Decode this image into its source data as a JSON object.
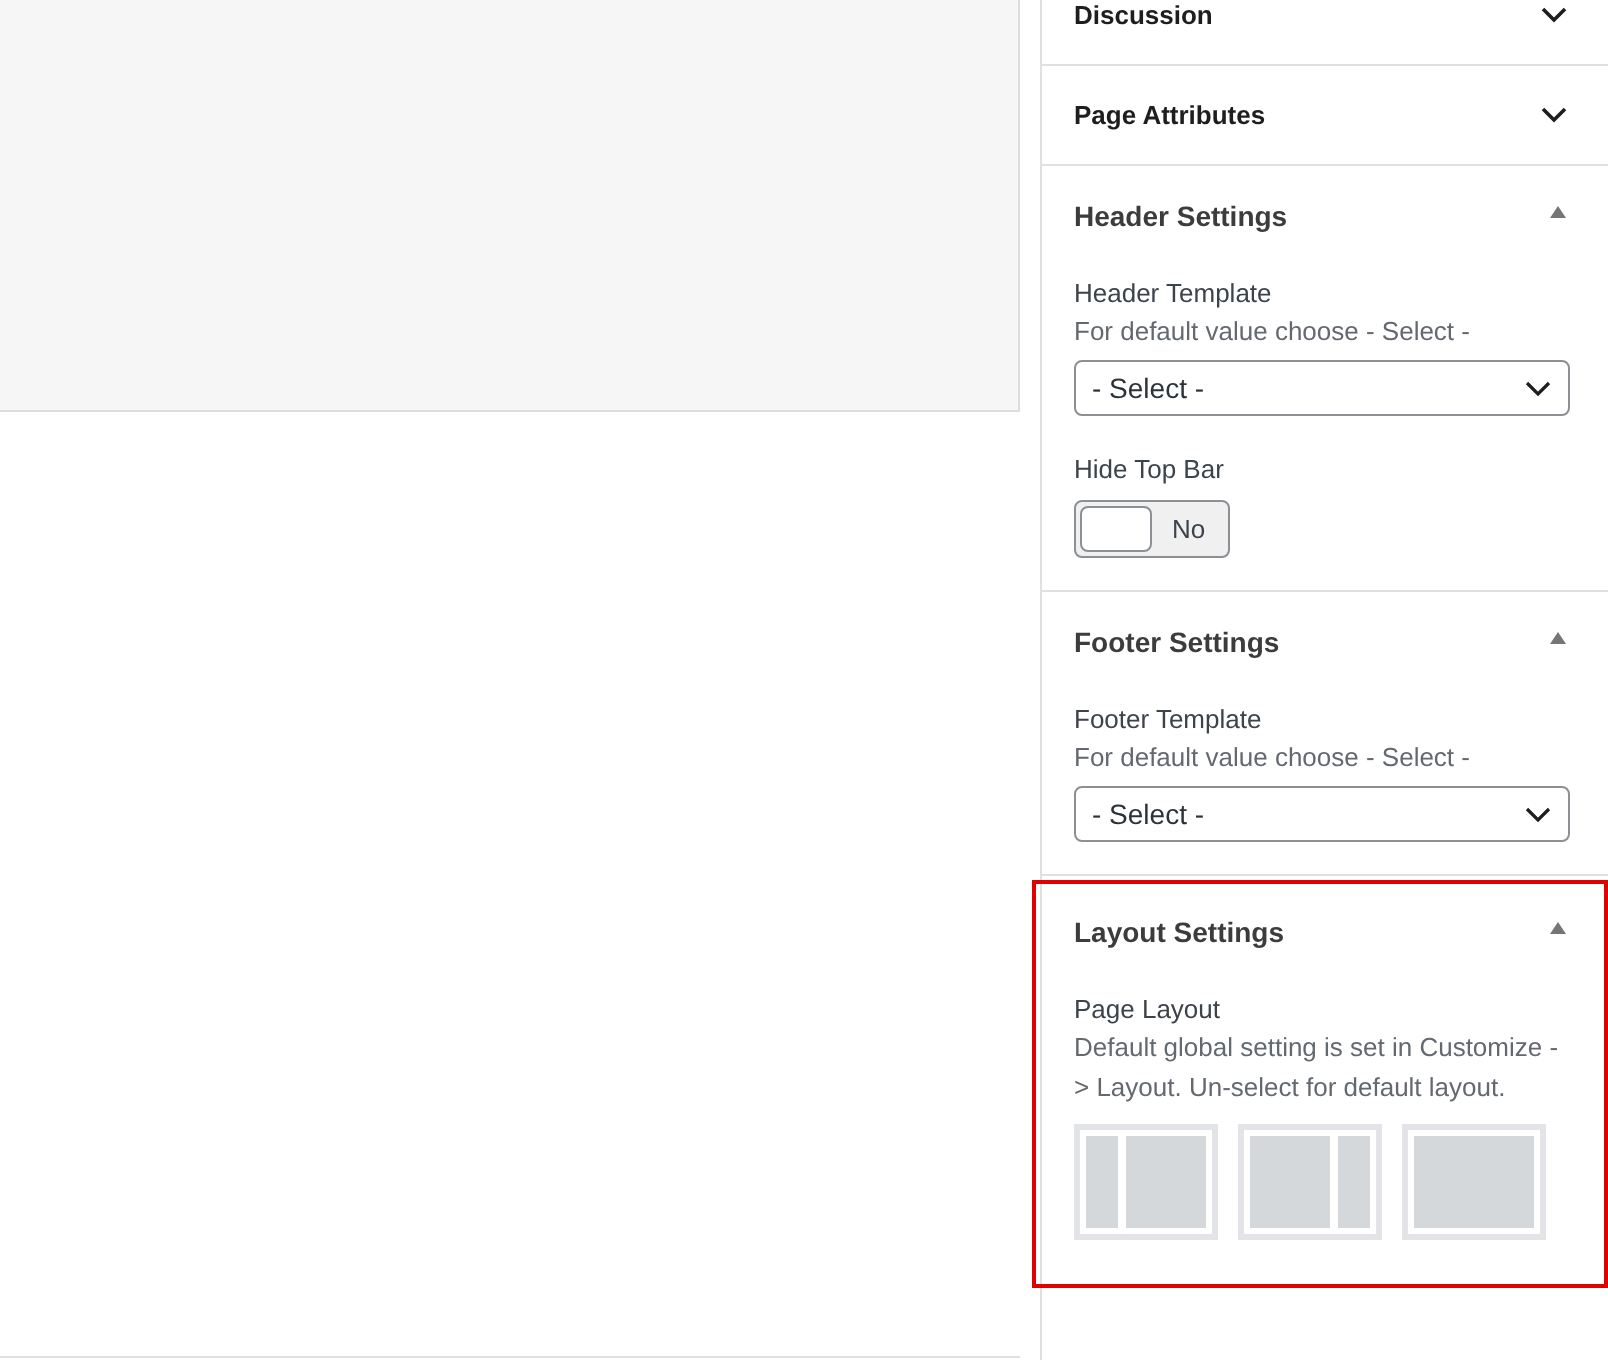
{
  "panels": [
    {
      "title": "Discussion",
      "expanded": false,
      "highlighted": false
    },
    {
      "title": "Page Attributes",
      "expanded": false,
      "highlighted": false
    },
    {
      "title": "Header Settings",
      "expanded": true,
      "highlighted": false,
      "fields": [
        {
          "kind": "select",
          "label": "Header Template",
          "help": "For default value choose - Select -",
          "value": "- Select -"
        },
        {
          "kind": "toggle",
          "label": "Hide Top Bar",
          "on": false,
          "state_label": "No"
        }
      ]
    },
    {
      "title": "Footer Settings",
      "expanded": true,
      "highlighted": false,
      "fields": [
        {
          "kind": "select",
          "label": "Footer Template",
          "help": "For default value choose - Select -",
          "value": "- Select -"
        }
      ]
    },
    {
      "title": "Layout Settings",
      "expanded": true,
      "highlighted": true,
      "fields": [
        {
          "kind": "layouts",
          "label": "Page Layout",
          "help": "Default global setting is set in Customize -> Layout. Un-select for default layout.",
          "options": [
            {
              "kind": "left-sidebar",
              "selected": false
            },
            {
              "kind": "right-sidebar",
              "selected": false
            },
            {
              "kind": "no-sidebar",
              "selected": false
            }
          ]
        }
      ]
    }
  ]
}
